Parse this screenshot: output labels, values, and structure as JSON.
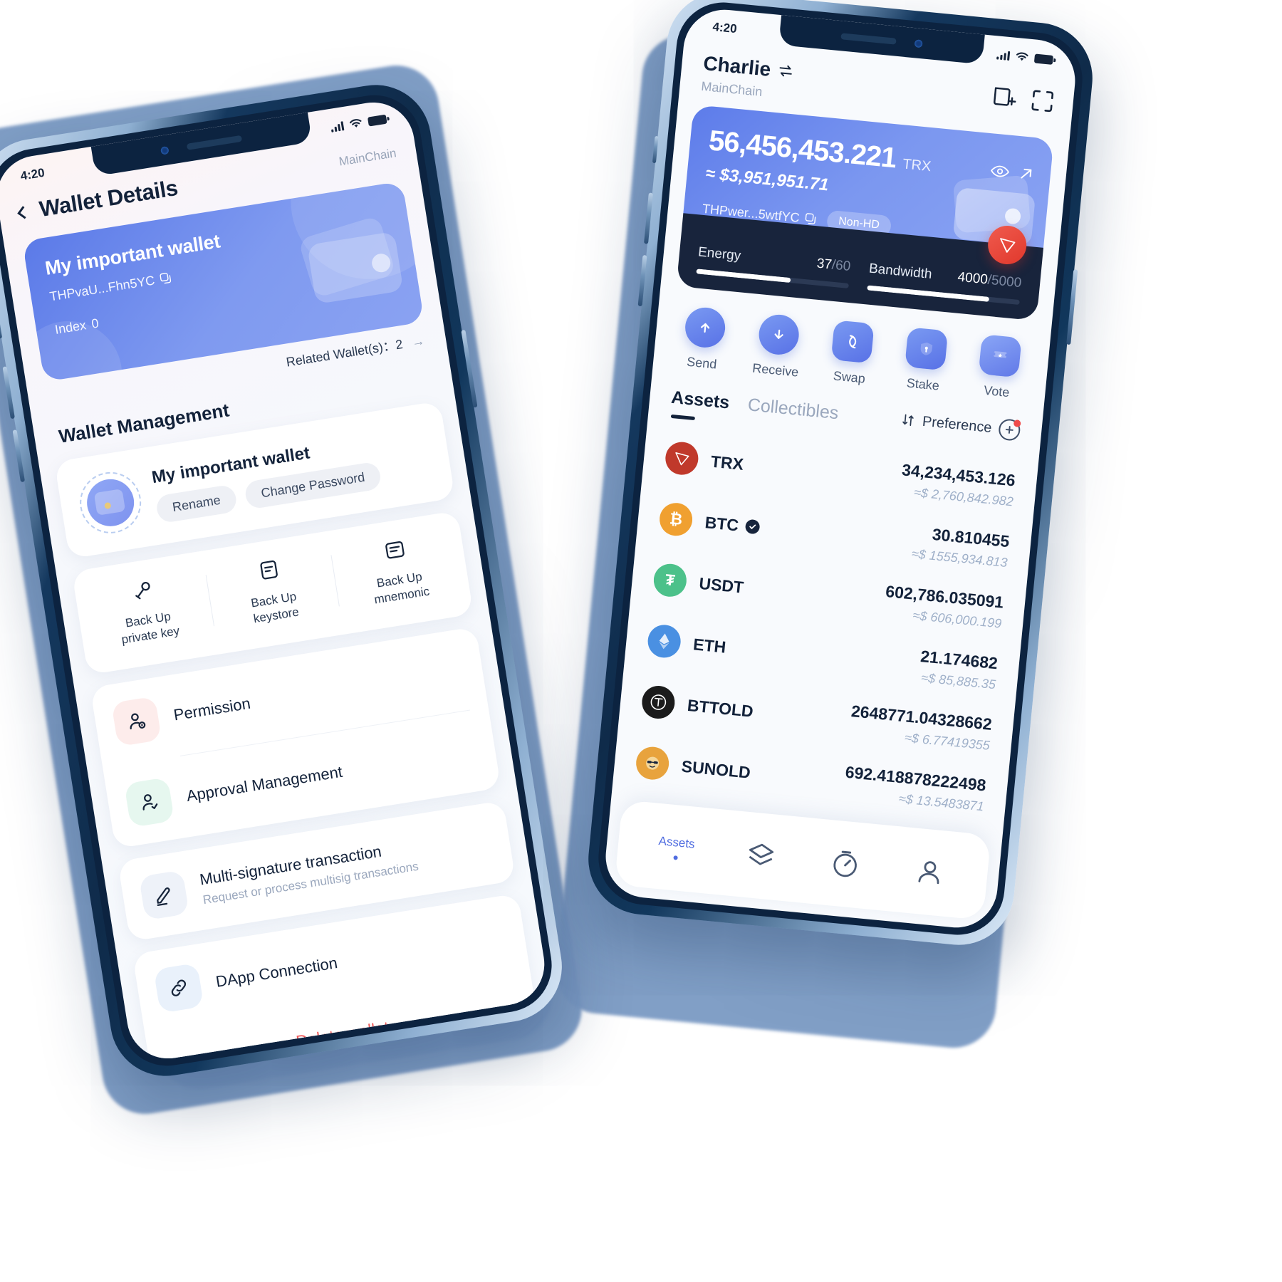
{
  "left_phone": {
    "status_bar": {
      "time": "4:20",
      "signal_icon": "cellular-bars-icon",
      "wifi_icon": "wifi-icon",
      "battery_icon": "battery-icon"
    },
    "header": {
      "back_icon": "back-chevron-icon",
      "title": "Wallet Details",
      "chain": "MainChain"
    },
    "wallet_card": {
      "name": "My important wallet",
      "address": "THPvaU...Fhn5YC",
      "copy_icon": "copy-icon",
      "index_label": "Index",
      "index_value": "0"
    },
    "related": {
      "label": "Related Wallet(s)：2",
      "arrow_icon": "arrow-right-icon"
    },
    "section_title": "Wallet Management",
    "wallet_row": {
      "avatar_icon": "wallet-avatar-icon",
      "name": "My important wallet",
      "rename_label": "Rename",
      "change_password_label": "Change Password"
    },
    "backup": [
      {
        "icon": "key-icon",
        "line1": "Back Up",
        "line2": "private key"
      },
      {
        "icon": "keystore-file-icon",
        "line1": "Back Up",
        "line2": "keystore"
      },
      {
        "icon": "mnemonic-list-icon",
        "line1": "Back Up",
        "line2": "mnemonic"
      }
    ],
    "menu": [
      {
        "icon": "permission-user-icon",
        "label": "Permission",
        "sub": "",
        "icon_bg": "#fdeceb"
      },
      {
        "icon": "approval-user-check-icon",
        "label": "Approval Management",
        "sub": "",
        "icon_bg": "#e6f7ef"
      },
      {
        "icon": "pencil-icon",
        "label": "Multi-signature transaction",
        "sub": "Request or process multisig transactions",
        "icon_bg": "#eef2f9"
      },
      {
        "icon": "link-chain-icon",
        "label": "DApp Connection",
        "sub": "",
        "icon_bg": "#e9f1fb"
      }
    ],
    "delete_label": "Delete wallet",
    "delete_color": "#ef5a5a"
  },
  "right_phone": {
    "status_bar": {
      "time": "4:20",
      "signal_icon": "cellular-bars-icon",
      "wifi_icon": "wifi-icon",
      "battery_icon": "battery-icon"
    },
    "header": {
      "account_name": "Charlie",
      "switch_icon": "account-switch-icon",
      "chain": "MainChain",
      "add_account_icon": "add-account-icon",
      "scan_icon": "scan-qr-icon"
    },
    "balance": {
      "amount": "56,456,453.221",
      "unit": "TRX",
      "usd": "≈ $3,951,951.71",
      "address": "THPwer...5wtfYC",
      "copy_icon": "copy-icon",
      "eye_icon": "eye-icon",
      "external_icon": "arrow-up-right-icon",
      "tag": "Non-HD"
    },
    "resources": [
      {
        "label": "Energy",
        "used": "37",
        "total": "60",
        "percent": 62
      },
      {
        "label": "Bandwidth",
        "used": "4000",
        "total": "5000",
        "percent": 80
      }
    ],
    "tron_badge_icon": "tron-logo-icon",
    "actions": [
      {
        "icon": "arrow-up-icon",
        "label": "Send"
      },
      {
        "icon": "arrow-down-icon",
        "label": "Receive"
      },
      {
        "icon": "swap-icon",
        "label": "Swap"
      },
      {
        "icon": "shield-icon",
        "label": "Stake"
      },
      {
        "icon": "ticket-icon",
        "label": "Vote"
      }
    ],
    "tabs": [
      {
        "label": "Assets",
        "active": true
      },
      {
        "label": "Collectibles",
        "active": false
      }
    ],
    "preference": {
      "sort_icon": "sort-arrows-icon",
      "label": "Preference",
      "add_icon": "add-token-icon"
    },
    "assets": [
      {
        "symbol": "TRX",
        "icon": "tron-coin-icon",
        "color": "#c0392b",
        "verified": false,
        "amount": "34,234,453.126",
        "usd": "≈$ 2,760,842.982"
      },
      {
        "symbol": "BTC",
        "icon": "bitcoin-coin-icon",
        "color": "#f0a030",
        "verified": true,
        "amount": "30.810455",
        "usd": "≈$ 1555,934.813"
      },
      {
        "symbol": "USDT",
        "icon": "tether-coin-icon",
        "color": "#4cc18a",
        "verified": false,
        "amount": "602,786.035091",
        "usd": "≈$ 606,000.199"
      },
      {
        "symbol": "ETH",
        "icon": "ethereum-coin-icon",
        "color": "#4a90e2",
        "verified": false,
        "amount": "21.174682",
        "usd": "≈$ 85,885.35"
      },
      {
        "symbol": "BTTOLD",
        "icon": "bittorrent-coin-icon",
        "color": "#1b1b1b",
        "verified": false,
        "amount": "2648771.04328662",
        "usd": "≈$ 6.77419355"
      },
      {
        "symbol": "SUNOLD",
        "icon": "sun-coin-icon",
        "color": "#e8a33d",
        "verified": false,
        "amount": "692.418878222498",
        "usd": "≈$ 13.5483871"
      }
    ],
    "bottom_nav": [
      {
        "icon": "assets-icon",
        "label": "Assets",
        "active": true
      },
      {
        "icon": "layers-icon",
        "label": "",
        "active": false
      },
      {
        "icon": "explore-icon",
        "label": "",
        "active": false
      },
      {
        "icon": "profile-icon",
        "label": "",
        "active": false
      }
    ]
  },
  "theme": {
    "accent_blue": "#5871e6",
    "card_gradient_start": "#5d7cea",
    "card_gradient_end": "#8aa3f3",
    "dark_navy": "#18243c",
    "danger_red": "#ef5a5a",
    "backdrop_blue": "#7b9ac4"
  }
}
